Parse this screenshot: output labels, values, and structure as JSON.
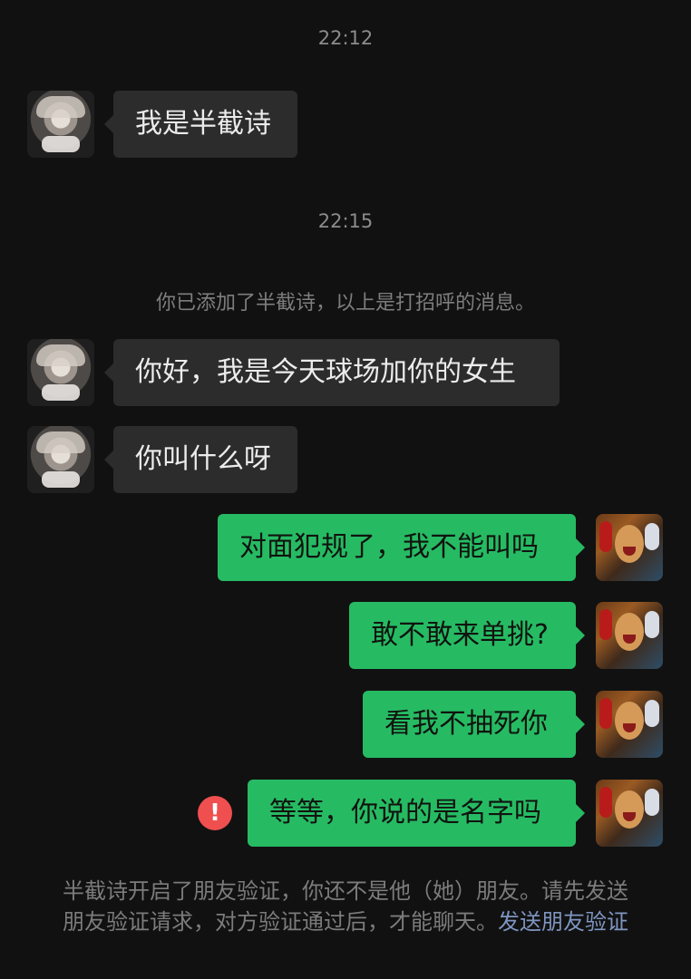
{
  "chat": {
    "time_1": "22:12",
    "time_2": "22:15",
    "system_notice": "你已添加了半截诗，以上是打招呼的消息。",
    "messages": [
      "我是半截诗",
      "你好，我是今天球场加你的女生",
      "你叫什么呀",
      "对面犯规了，我不能叫吗",
      "敢不敢来单挑?",
      "看我不抽死你",
      "等等，你说的是名字吗"
    ],
    "error_symbol": "!",
    "footer_text": "半截诗开启了朋友验证，你还不是他（她）朋友。请先发送朋友验证请求，对方验证通过后，才能聊天。",
    "footer_link": "发送朋友验证"
  },
  "colors": {
    "background": "#111111",
    "incoming_bubble": "#2c2c2c",
    "outgoing_bubble": "#26bb63",
    "error": "#ef4f4f",
    "link": "#7f95c1"
  },
  "icons": {
    "error": "exclamation-circle-icon"
  }
}
